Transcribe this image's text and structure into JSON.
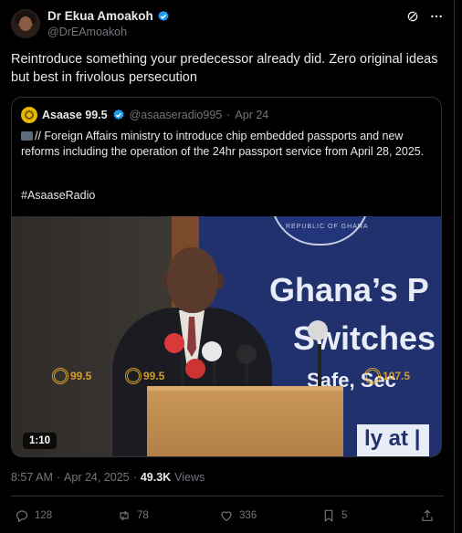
{
  "author": {
    "display_name": "Dr Ekua Amoakoh",
    "handle": "@DrEAmoakoh"
  },
  "header_icons": [
    "grok-icon",
    "more-icon"
  ],
  "tweet": {
    "text": "Reintroduce something your predecessor already did. Zero original ideas but best in frivolous persecution"
  },
  "quoted": {
    "display_name": "Asaase 99.5",
    "handle": "@asaaseradio995",
    "separator": "·",
    "date": "Apr 24",
    "text": "// Foreign Affairs ministry to introduce chip embedded passports  and new reforms including the operation of the 24hr passport service from April 28, 2025.",
    "hashtag": "#AsaaseRadio",
    "video": {
      "duration": "1:10",
      "seal_text": "REPUBLIC OF GHANA",
      "banner_line1": "Ghana’s P",
      "banner_line2": "Switches",
      "banner_line3": "Safe, Sec",
      "banner_bottom": "ly at  |",
      "watermark_1": "99.5",
      "watermark_2": "99.5",
      "watermark_3": "107.5"
    }
  },
  "meta": {
    "time": "8:57 AM",
    "separator1": "·",
    "date": "Apr 24, 2025",
    "separator2": "·",
    "views_count": "49.3K",
    "views_label": "Views"
  },
  "actions": {
    "replies": "128",
    "reposts": "78",
    "likes": "336",
    "bookmarks": "5"
  },
  "colors": {
    "background": "#000000",
    "text": "#e7e9ea",
    "secondary": "#71767b",
    "border": "#2f3336",
    "verified": "#1d9bf0"
  }
}
